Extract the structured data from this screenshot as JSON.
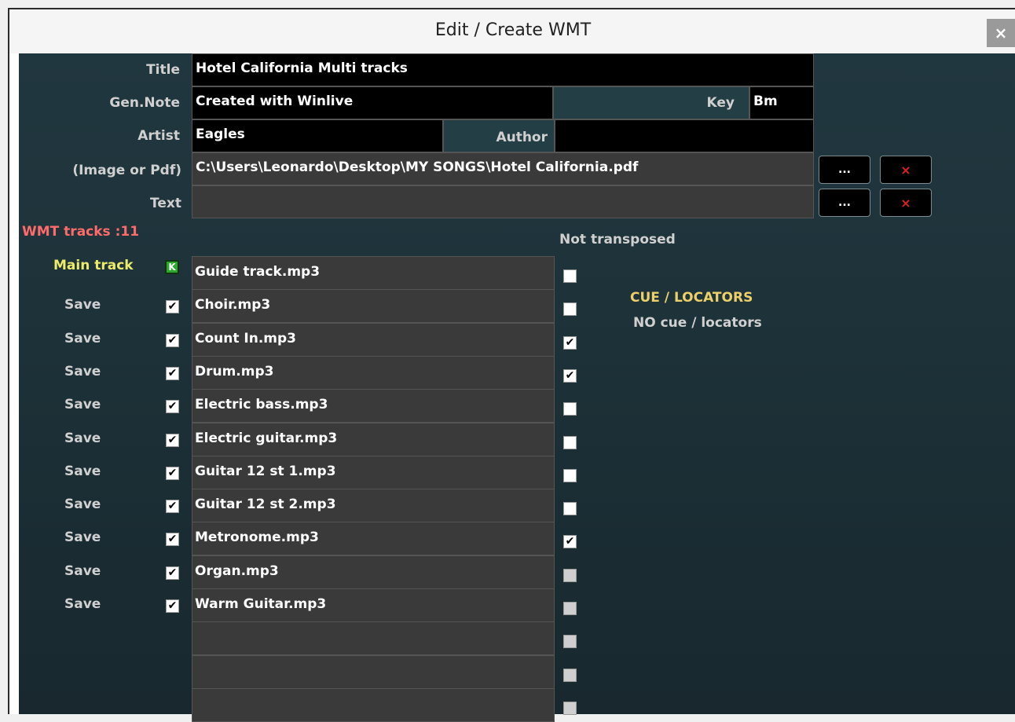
{
  "window": {
    "title": "Edit / Create WMT",
    "close_icon": "×"
  },
  "form": {
    "title_label": "Title",
    "title_value": "Hotel California Multi tracks",
    "gen_note_label": "Gen.Note",
    "gen_note_value": "Created with Winlive",
    "key_label": "Key",
    "key_value": "Bm",
    "artist_label": "Artist",
    "artist_value": "Eagles",
    "author_label": "Author",
    "author_value": "",
    "image_label": "(Image or Pdf)",
    "image_value": "C:\\Users\\Leonardo\\Desktop\\MY SONGS\\Hotel California.pdf",
    "text_label": "Text",
    "text_value": "",
    "browse_label": "...",
    "clear_label": "×"
  },
  "tracks_header": {
    "count_label": "WMT tracks :11",
    "not_transposed_label": "Not transposed",
    "main_track_label": "Main track",
    "main_icon": "K",
    "save_label": "Save"
  },
  "tracks": [
    {
      "name": "Guide track.mp3",
      "save": null,
      "not_transposed": false
    },
    {
      "name": "Choir.mp3",
      "save": true,
      "not_transposed": false
    },
    {
      "name": "Count In.mp3",
      "save": true,
      "not_transposed": true
    },
    {
      "name": "Drum.mp3",
      "save": true,
      "not_transposed": true
    },
    {
      "name": "Electric bass.mp3",
      "save": true,
      "not_transposed": false
    },
    {
      "name": "Electric guitar.mp3",
      "save": true,
      "not_transposed": false
    },
    {
      "name": "Guitar 12 st 1.mp3",
      "save": true,
      "not_transposed": false
    },
    {
      "name": "Guitar 12 st 2.mp3",
      "save": true,
      "not_transposed": false
    },
    {
      "name": "Metronome.mp3",
      "save": true,
      "not_transposed": true
    },
    {
      "name": "Organ.mp3",
      "save": true,
      "not_transposed": false
    },
    {
      "name": "Warm Guitar.mp3",
      "save": true,
      "not_transposed": false
    },
    {
      "name": "",
      "save": null,
      "not_transposed": false
    },
    {
      "name": "",
      "save": null,
      "not_transposed": false
    },
    {
      "name": "",
      "save": null,
      "not_transposed": false
    }
  ],
  "cue": {
    "title": "CUE / LOCATORS",
    "status": "NO cue / locators"
  },
  "colors": {
    "count_label": "#ff6b6b",
    "main_track_label": "#ecec6a",
    "cue_title": "#ecd06a",
    "panel_bg": "#21373f"
  },
  "icons": {
    "browse": "ellipsis-icon",
    "clear": "close-icon",
    "main": "k-key-icon",
    "checked": "checkmark-icon"
  }
}
